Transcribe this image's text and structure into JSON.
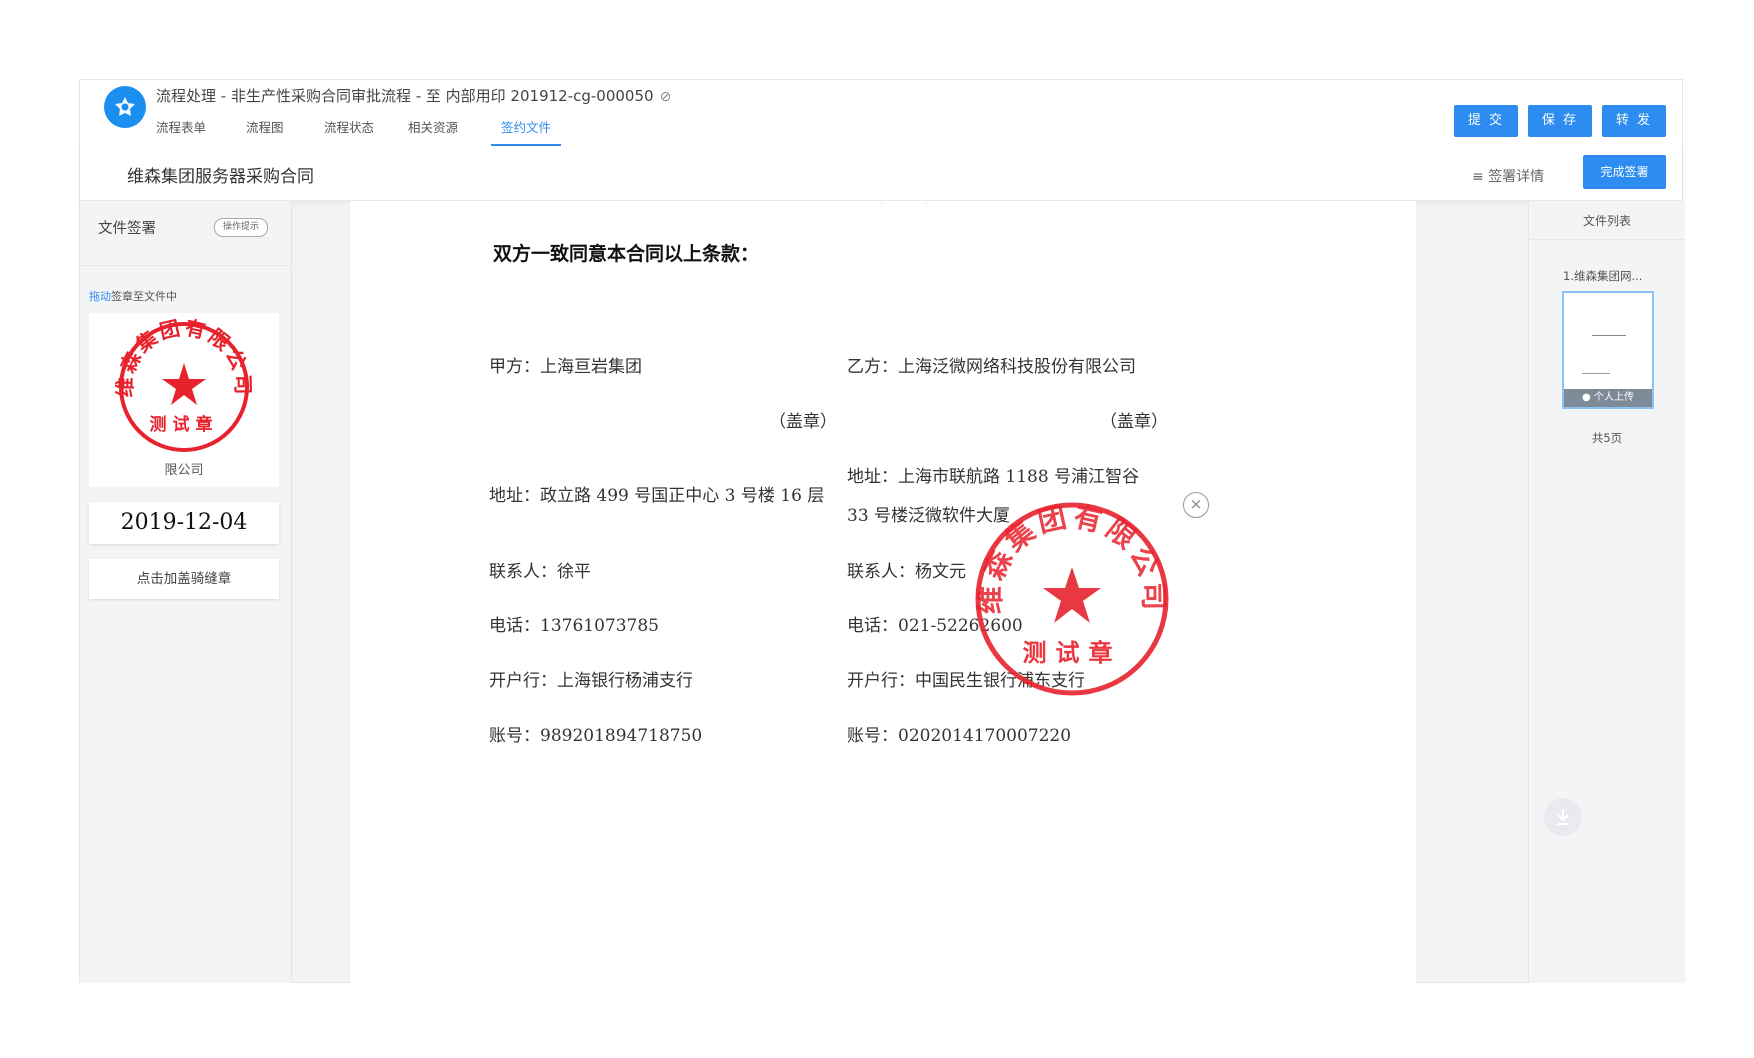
{
  "header": {
    "title": "流程处理 - 非生产性采购合同审批流程 - 至 内部用印 201912-cg-000050",
    "tabs": [
      {
        "label": "流程表单"
      },
      {
        "label": "流程图"
      },
      {
        "label": "流程状态"
      },
      {
        "label": "相关资源"
      },
      {
        "label": "签约文件",
        "active": true
      }
    ],
    "actions": {
      "submit": "提 交",
      "save": "保 存",
      "forward": "转 发"
    }
  },
  "subbar": {
    "doc_title": "维森集团服务器采购合同",
    "sign_detail": "签署详情",
    "finish_sign": "完成签署"
  },
  "left_panel": {
    "heading": "文件签署",
    "hint_button": "操作提示",
    "drag_tip_highlight": "拖动",
    "drag_tip_rest": "签章至文件中",
    "seal": {
      "ring_text": "维森集团有限公司",
      "bottom_text": "测试章",
      "label": "限公司"
    },
    "date_seal": "2019-12-04",
    "riding_seal_button": "点击加盖骑缝章"
  },
  "document": {
    "heading": "双方一致同意本合同以上条款：",
    "party_a": {
      "name_label": "甲方：上海亘岩集团",
      "seal_note": "（盖章）",
      "address": "地址：政立路 499 号国正中心 3 号楼 16 层",
      "contact": "联系人：徐平",
      "phone": "电话：13761073785",
      "bank": "开户行：上海银行杨浦支行",
      "account": "账号：989201894718750"
    },
    "party_b": {
      "name_label": "乙方：上海泛微网络科技股份有限公司",
      "seal_note": "（盖章）",
      "address_line1": "地址：上海市联航路 1188 号浦江智谷",
      "address_line2": "33 号楼泛微软件大厦",
      "contact": "联系人：杨文元",
      "phone": "电话：021-52262600",
      "bank": "开户行：中国民生银行浦东支行",
      "account": "账号：0202014170007220"
    },
    "placed_seal": {
      "ring_text": "维森集团有限公司",
      "bottom_text": "测试章"
    },
    "remove_seal_icon": "×"
  },
  "right_panel": {
    "heading": "文件列表",
    "file_name": "1.维森集团网...",
    "thumb_tag": "个人上传",
    "page_count": "共5页"
  },
  "colors": {
    "accent": "#2d8cf0",
    "seal_red": "#e8222d"
  }
}
